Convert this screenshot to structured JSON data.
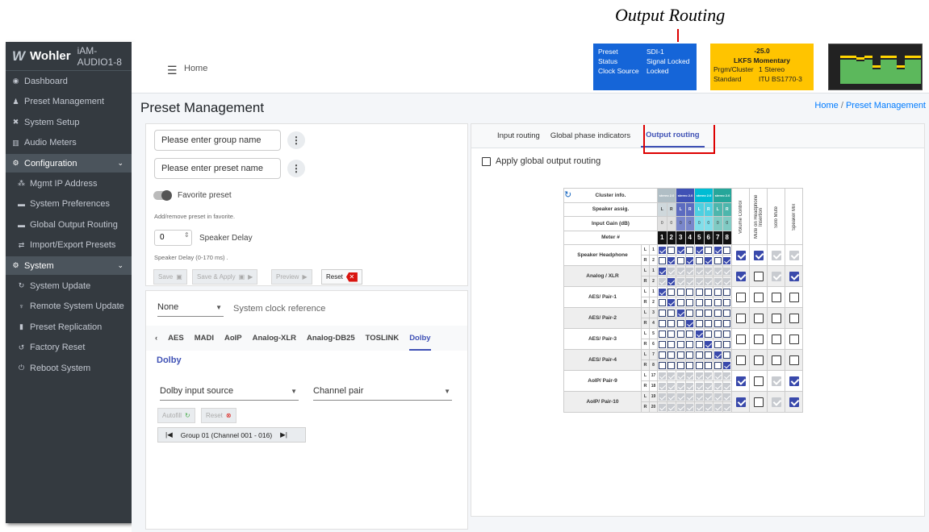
{
  "callout": "Output Routing",
  "sidebar": {
    "brand_logo": "Wohler",
    "model": "iAM-AUDIO1-8",
    "items": [
      {
        "label": "Dashboard",
        "icon": "dashboard-icon",
        "glyph": "◉"
      },
      {
        "label": "Preset Management",
        "icon": "user-edit-icon",
        "glyph": "♟"
      },
      {
        "label": "System Setup",
        "icon": "tools-icon",
        "glyph": "✖"
      },
      {
        "label": "Audio Meters",
        "icon": "chart-icon",
        "glyph": "▥"
      },
      {
        "label": "Configuration",
        "icon": "gear-icon",
        "glyph": "⚙"
      },
      {
        "label": "Mgmt IP Address",
        "icon": "network-icon",
        "glyph": "⁂"
      },
      {
        "label": "System Preferences",
        "icon": "hdd-icon",
        "glyph": "▬"
      },
      {
        "label": "Global Output Routing",
        "icon": "hdd-icon",
        "glyph": "▬"
      },
      {
        "label": "Import/Export Presets",
        "icon": "exchange-icon",
        "glyph": "⇄"
      },
      {
        "label": "System",
        "icon": "gears-icon",
        "glyph": "⚙"
      },
      {
        "label": "System Update",
        "icon": "sync-icon",
        "glyph": "↻"
      },
      {
        "label": "Remote System Update",
        "icon": "satellite-icon",
        "glyph": "♆"
      },
      {
        "label": "Preset Replication",
        "icon": "copy-icon",
        "glyph": "▮"
      },
      {
        "label": "Factory Reset",
        "icon": "undo-icon",
        "glyph": "↺"
      },
      {
        "label": "Reboot System",
        "icon": "power-icon",
        "glyph": "⏻"
      }
    ]
  },
  "topbar": {
    "home": "Home"
  },
  "status": {
    "rows": [
      [
        "Preset",
        "SDI-1"
      ],
      [
        "Status",
        "Signal Locked"
      ],
      [
        "Clock Source",
        "Locked"
      ]
    ]
  },
  "loudness": {
    "value": "-25.0",
    "mode": "LKFS  Momentary",
    "rows": [
      [
        "Prgm/Cluster",
        "1  Stereo"
      ],
      [
        "Standard",
        "ITU BS1770-3"
      ]
    ]
  },
  "page": {
    "title": "Preset Management",
    "crumb_home": "Home",
    "crumb_sep": "/",
    "crumb_current": "Preset Management"
  },
  "preset_form": {
    "group_placeholder": "Please enter group name",
    "preset_placeholder": "Please enter preset name",
    "favorite": "Favorite preset",
    "favorite_hint": "Add/remove preset in favorite.",
    "delay_value": "0",
    "delay_label": "Speaker Delay",
    "delay_hint": "Speaker Delay (0-170 ms) .",
    "save": "Save",
    "save_apply": "Save & Apply",
    "preview": "Preview",
    "reset": "Reset"
  },
  "input_panel": {
    "clock_value": "None",
    "clock_label": "System clock reference",
    "tabs": [
      "AES",
      "MADI",
      "AoIP",
      "Analog-XLR",
      "Analog-DB25",
      "TOSLINK",
      "Dolby"
    ],
    "active_tab": "Dolby",
    "section": "Dolby",
    "source": "Dolby input source",
    "pair": "Channel pair",
    "autofill": "Autofill",
    "reset": "Reset",
    "group": "Group 01 (Channel 001 - 016)"
  },
  "routing": {
    "tabs": [
      "Input routing",
      "Global phase indicators",
      "Output routing"
    ],
    "active": "Output routing",
    "apply_global": "Apply global output routing",
    "headers": {
      "cluster": "Cluster info.",
      "speaker": "Speaker assig.",
      "gain": "Input Gain (dB)",
      "meter": "Meter #"
    },
    "cluster": [
      "stereo 2.0",
      "stereo 2.0",
      "stereo 2.0",
      "stereo 2.0"
    ],
    "speaker": [
      "L",
      "R",
      "L",
      "R",
      "L",
      "R",
      "L",
      "R"
    ],
    "gain": [
      "0",
      "0",
      "0",
      "0",
      "0",
      "0",
      "0",
      "0"
    ],
    "meters": [
      "1",
      "2",
      "3",
      "4",
      "5",
      "6",
      "7",
      "8"
    ],
    "col_headers": [
      "Volume Control",
      "Mute on Headphone Insertion",
      "Solo Mute",
      "Speaker Mix"
    ]
  }
}
